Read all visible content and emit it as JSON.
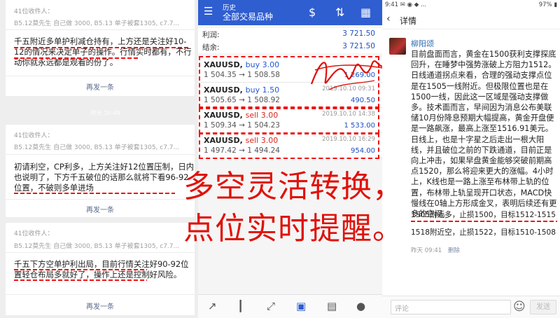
{
  "left_cards": [
    {
      "header": "41位收件人：",
      "meta": "B5.12莫先生 自己做 3000, B5.13 单子被套1305, c7.7...",
      "body": "千五附近多单护利减仓持有，上方还是关注好10-12的情况来决定单子的操作。行情实时都有，不行动你就永远都是观看的份了。",
      "more": "再发一条"
    },
    {
      "header": "41位收件人：",
      "meta": "B5.12莫先生 自己做 3000, B5.13 单子被套1305, c7.7...",
      "body": "初请利空，CP利多，上方关注好12位置压制，日内也说明了，下方千五破位的话那么就将下看96-92位置，不破则多单进场",
      "more": "再发一条"
    },
    {
      "header": "41位收件人：",
      "meta": "B5.12莫先生 自己做 3000, B5.13 单子被套1305, c7.7...",
      "body": "千五下方空单护利出局，目前行情关注好90-92位置轻仓布局多就好了，操作上还是控制好风险。",
      "more": "再发一条"
    }
  ],
  "left_timestamp": "昨天 20:48",
  "mid": {
    "header_title": "历史",
    "header_subtitle": "全部交易品种",
    "summary": [
      {
        "label": "利润:",
        "value": "3 721.50"
      },
      {
        "label": "结余:",
        "value": "3 721.50"
      }
    ],
    "trades": [
      {
        "symbol": "XAUUSD,",
        "dir": "buy 3.00",
        "side": "buy",
        "prices": "1 504.35 → 1 508.58",
        "datetime": "",
        "pl": "1 269.00"
      },
      {
        "symbol": "XAUUSD,",
        "dir": "buy 1.50",
        "side": "buy",
        "prices": "1 505.65 → 1 508.92",
        "datetime": "2019.10.10 09:31",
        "pl": "490.50"
      },
      {
        "symbol": "XAUUSD,",
        "dir": "sell 3.00",
        "side": "sell",
        "prices": "1 509.34 → 1 504.23",
        "datetime": "2019.10.10 14:38",
        "pl": "1 533.00"
      },
      {
        "symbol": "XAUUSD,",
        "dir": "sell 3.00",
        "side": "sell",
        "prices": "1 497.42 → 1 494.24",
        "datetime": "2019.10.10 16:29",
        "pl": "954.00"
      }
    ]
  },
  "right": {
    "status_left": "9:41 ✉ ◉ ◆ ...",
    "status_right": "97% ▮",
    "title": "详情",
    "author": "柳阳颂",
    "post_main": "目前盘面而言，黄金在1500获利支撑探底回升，在睡梦中强势涨破上方阻力1512。日线通道拐点来看，合理的强动支撑点位是在1505一线附近。但极限位置也是在1500一线，因此这一区域是强动支撑做多。技术面而言，早间因为消息公布美联储10月份降息预期大幅提高，黄金开盘便是一路飙涨，最高上涨至1516.91美元。日线上，也是十字星之后走出一根大阳线，并且破位之前的下跌通道，目前正是向上冲击，如果早盘黄金能够突破前期高点1520，那么将迎来更大的涨幅。4小时上，K线也是一路上涨至布林带上轨的位置，布林带上轨呈现开口状态，MACD快慢线在0轴上方形成金叉，表明后续还有更多的空间。",
    "post_signal1": "1505附近多，止损1500，目标1512-1515",
    "post_signal2": "1518附近空，止损1522，目标1510-1508",
    "post_time": "昨天 09:41",
    "post_delete": "删除",
    "comment_placeholder": "评论",
    "send_label": "发送"
  },
  "overlay": {
    "line1": "多空灵活转换，",
    "line2": "点位实时提醒。"
  },
  "colors": {
    "accent_blue": "#2f5ed1",
    "highlight_red": "#e0120b",
    "profit_blue": "#1f4fbf"
  }
}
